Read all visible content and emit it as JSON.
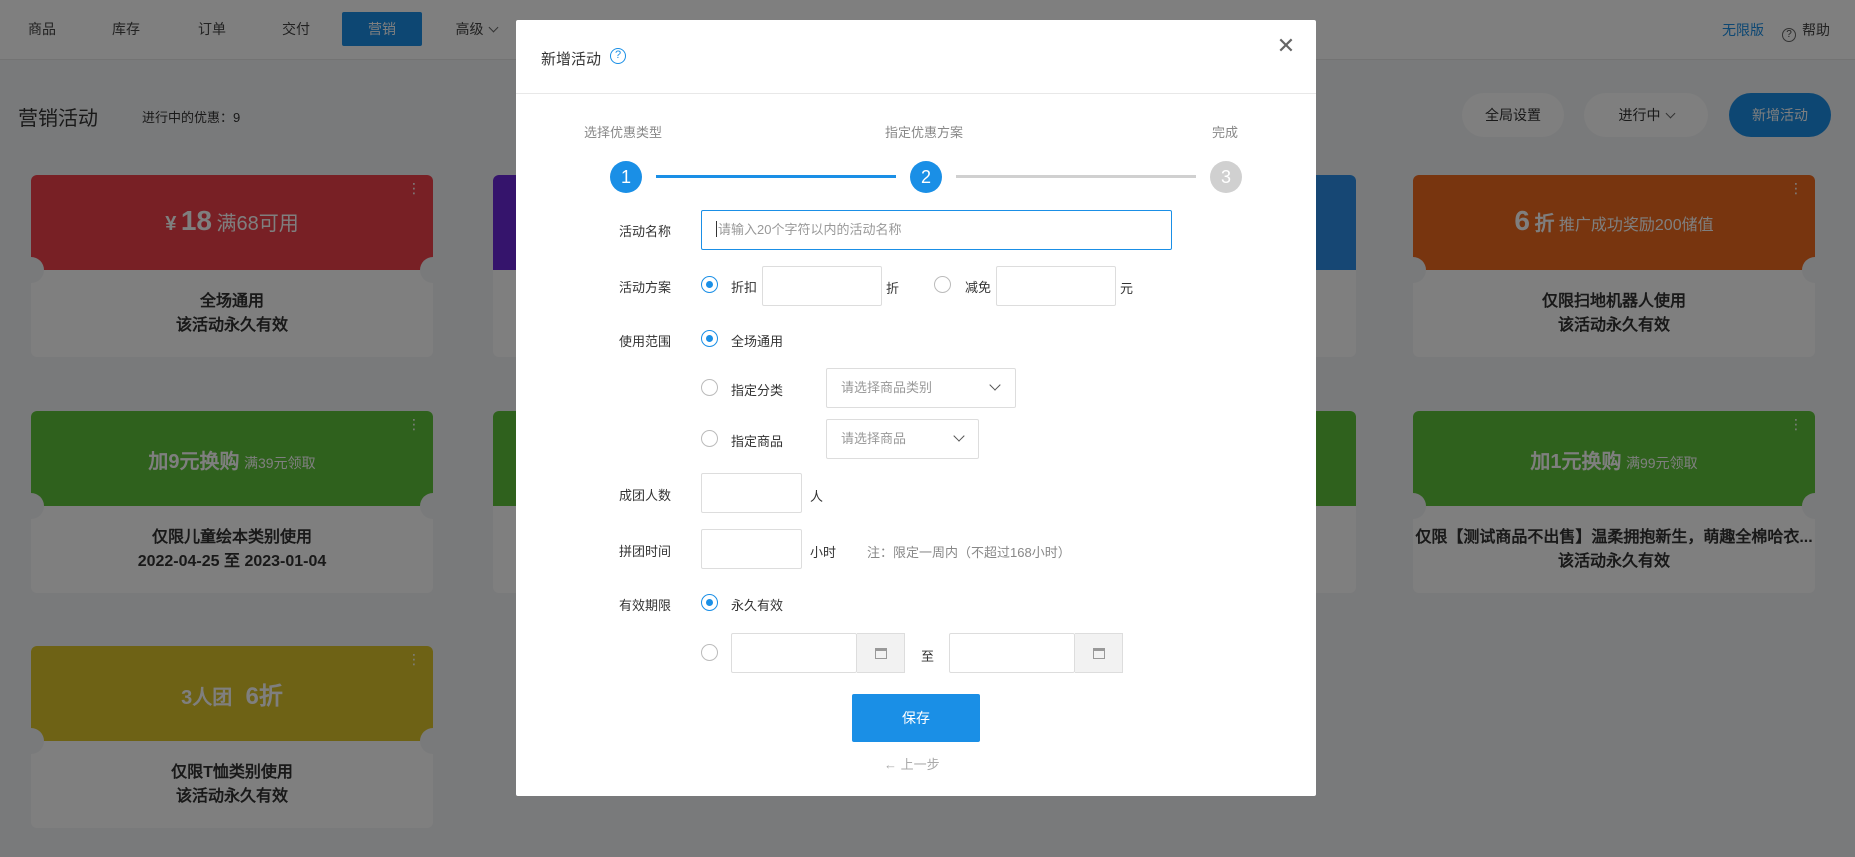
{
  "nav": {
    "items": [
      "商品",
      "库存",
      "订单",
      "交付",
      "营销",
      "高级"
    ],
    "edition": "无限版",
    "help": "帮助"
  },
  "page": {
    "title": "营销活动",
    "ongoing": "进行中的优惠：9",
    "global_settings": "全局设置",
    "status_filter": "进行中",
    "new_activity": "新增活动"
  },
  "cards": {
    "c1": {
      "prefix": "¥",
      "value": "18",
      "cond": "满68可用",
      "line1": "全场通用",
      "line2": "该活动永久有效"
    },
    "c4": {
      "value": "6",
      "unit": "折",
      "cond": "推广成功奖励200储值",
      "line1": "仅限扫地机器人使用",
      "line2": "该活动永久有效"
    },
    "c5": {
      "main": "加9元换购",
      "cond": "满39元领取",
      "line1": "仅限儿童绘本类别使用",
      "line2": "2022-04-25 至 2023-01-04"
    },
    "c8": {
      "main": "加1元换购",
      "cond": "满99元领取",
      "line1": "仅限【测试商品不出售】温柔拥抱新生，萌趣全棉哈衣...",
      "line2": "该活动永久有效"
    },
    "c9": {
      "main": "3人团",
      "discount": "6折",
      "line1": "仅限T恤类别使用",
      "line2": "该活动永久有效"
    }
  },
  "modal": {
    "title": "新增活动",
    "help_icon": "question-icon",
    "close_icon": "close-icon",
    "steps": [
      {
        "num": "1",
        "label": "选择优惠类型"
      },
      {
        "num": "2",
        "label": "指定优惠方案"
      },
      {
        "num": "3",
        "label": "完成"
      }
    ],
    "name_label": "活动名称",
    "name_placeholder": "请输入20个字符以内的活动名称",
    "plan_label": "活动方案",
    "discount_option": "折扣",
    "discount_unit": "折",
    "reduce_option": "减免",
    "reduce_unit": "元",
    "scope_label": "使用范围",
    "scope_all": "全场通用",
    "scope_category": "指定分类",
    "category_placeholder": "请选择商品类别",
    "scope_product": "指定商品",
    "product_placeholder": "请选择商品",
    "group_label": "成团人数",
    "group_unit": "人",
    "time_label": "拼团时间",
    "time_unit": "小时",
    "time_note": "注：限定一周内（不超过168小时）",
    "validity_label": "有效期限",
    "validity_forever": "永久有效",
    "to": "至",
    "save": "保存",
    "back": "← 上一步"
  },
  "colors": {
    "primary": "#1a8fe6",
    "step_inactive": "#d0d0d0"
  }
}
